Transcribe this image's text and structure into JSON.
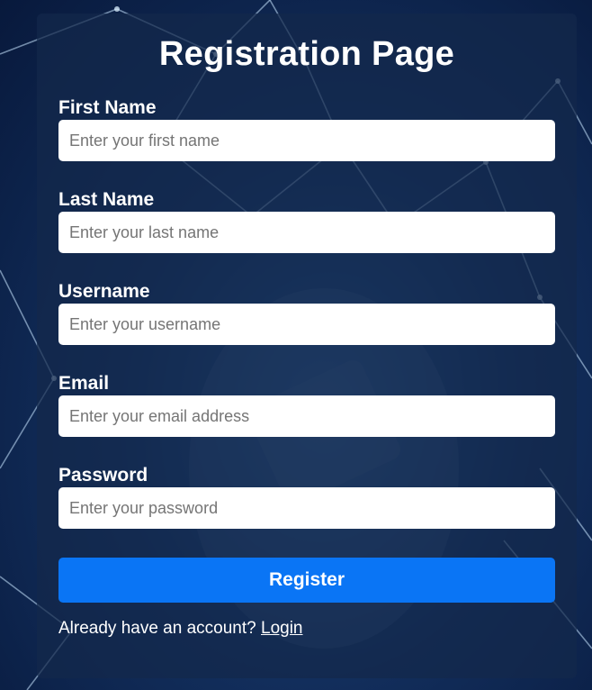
{
  "page": {
    "title": "Registration Page"
  },
  "form": {
    "fields": [
      {
        "label": "First Name",
        "placeholder": "Enter your first name",
        "value": ""
      },
      {
        "label": "Last Name",
        "placeholder": "Enter your last name",
        "value": ""
      },
      {
        "label": "Username",
        "placeholder": "Enter your username",
        "value": ""
      },
      {
        "label": "Email",
        "placeholder": "Enter your email address",
        "value": ""
      },
      {
        "label": "Password",
        "placeholder": "Enter your password",
        "value": ""
      }
    ],
    "submit_label": "Register"
  },
  "footer": {
    "prompt_text": "Already have an account?",
    "login_label": "Login"
  },
  "colors": {
    "accent": "#0a75f5",
    "card_background": "#14284b",
    "text": "#ffffff"
  }
}
